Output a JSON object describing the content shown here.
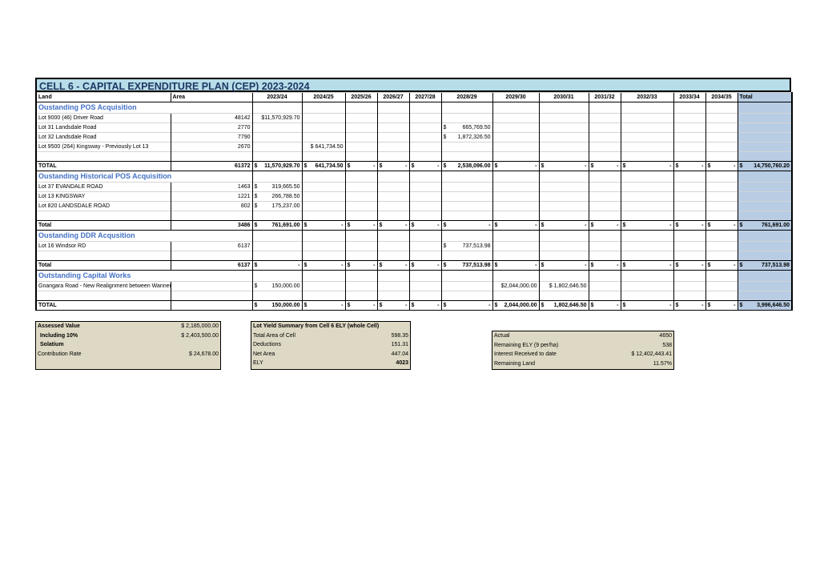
{
  "title": "CELL 6 - CAPITAL EXPENDITURE PLAN (CEP) 2023-2024",
  "columns": [
    "Land",
    "Area",
    "2023/24",
    "2024/25",
    "2025/26",
    "2026/27",
    "2027/28",
    "2028/29",
    "2029/30",
    "2030/31",
    "2031/32",
    "2032/33",
    "2033/34",
    "2034/35",
    "Total"
  ],
  "sections": [
    {
      "heading": "Oustanding POS Acquisition",
      "rows": [
        {
          "land": "Lot 9000 (46) Driver Road",
          "area": "48142",
          "vals": {
            "2023/24": [
              "",
              "$11,570,929.70"
            ]
          }
        },
        {
          "land": "Lot 31 Landsdale Road",
          "area": "2770",
          "vals": {
            "2028/29": [
              "$",
              "665,769.50"
            ]
          }
        },
        {
          "land": "Lot 32 Landsdale Road",
          "area": "7790",
          "vals": {
            "2028/29": [
              "$",
              "1,872,326.50"
            ]
          }
        },
        {
          "land": "Lot 9500 (264) Kingsway - Previously Lot 13",
          "area": "2670",
          "vals": {
            "2024/25": [
              "",
              "$ 641,734.50"
            ]
          }
        }
      ],
      "total_label": "TOTAL",
      "total_area": "61372",
      "totals": [
        "$11,570,929.70",
        "$ 641,734.50",
        "$ -",
        "$ -",
        "$ -",
        "$ 2,538,096.00",
        "$ -",
        "$ -",
        "$ -",
        "$ -",
        "$ -",
        "$ -",
        "$ 14,750,760.20"
      ]
    },
    {
      "heading": "Oustanding Historical POS Acquisition",
      "rows": [
        {
          "land": "Lot 37 EVANDALE ROAD",
          "area": "1463",
          "vals": {
            "2023/24": [
              "$",
              "319,665.50"
            ]
          }
        },
        {
          "land": "Lot 13 KINGSWAY",
          "area": "1221",
          "vals": {
            "2023/24": [
              "$",
              "266,788.50"
            ]
          }
        },
        {
          "land": "Lot 820  LANDSDALE ROAD",
          "area": "802",
          "vals": {
            "2023/24": [
              "$",
              "175,237.00"
            ]
          }
        }
      ],
      "total_label": "Total",
      "total_area": "3486",
      "totals": [
        "$ 761,691.00",
        "$ -",
        "$ -",
        "$ -",
        "$ -",
        "$ -",
        "$ -",
        "$ -",
        "$ -",
        "$ -",
        "$ -",
        "$ -",
        "$ 761,691.00"
      ]
    },
    {
      "heading": "Oustanding DDR Acqusition",
      "rows": [
        {
          "land": "Lot 16 Windsor RD",
          "area": "6137",
          "vals": {
            "2028/29": [
              "$",
              "737,513.98"
            ]
          }
        }
      ],
      "total_label": "Total",
      "total_area": "6137",
      "totals": [
        "$ -",
        "$ -",
        "$ -",
        "$ -",
        "$ -",
        "$ 737,513.98",
        "$ -",
        "$ -",
        "$ -",
        "$ -",
        "$ -",
        "$ -",
        "$ 737,513.98"
      ]
    },
    {
      "heading": "Outstanding Capital Works",
      "rows": [
        {
          "land": "Gnangara Road - New Realignment between Wanneroo Rd to Hartman Drive",
          "area": "",
          "vals": {
            "2023/24": [
              "$",
              "150,000.00"
            ],
            "2029/30": [
              "",
              "$2,044,000.00"
            ],
            "2030/31": [
              "",
              "$ 1,802,646.50"
            ]
          }
        }
      ],
      "total_label": "TOTAL",
      "total_area": "",
      "totals": [
        "$ 150,000.00",
        "$ -",
        "$ -",
        "$ -",
        "$ -",
        "$ -",
        "$2,044,000.00",
        "$ 1,802,646.50",
        "$ -",
        "$ -",
        "$ -",
        "$ -",
        "$ 3,996,646.50"
      ]
    }
  ],
  "assessed": [
    {
      "label": "Assessed Value",
      "value": "$ 2,185,000.00",
      "bold": true
    },
    {
      "label": "Including 10%",
      "value": "$ 2,403,500.00",
      "bold": true
    },
    {
      "label": "Solatium",
      "value": "",
      "bold": true
    },
    {
      "label": "Contribution Rate",
      "value": "$ 24,678.00",
      "bold": false
    }
  ],
  "lot_yield": {
    "heading": "Lot Yield Summary from Cell 6 ELY (whole Cell)",
    "rows": [
      {
        "label": "Total Area of Cell",
        "value": "598.35"
      },
      {
        "label": "Deductions",
        "value": "151.31"
      },
      {
        "label": "Net Area",
        "value": "447.04"
      },
      {
        "label": "ELY",
        "value": "4023"
      }
    ]
  },
  "actual": [
    {
      "label": "Actual",
      "value": "4650"
    },
    {
      "label": "Remaining ELY (9 per/ha)",
      "value": "538"
    },
    {
      "label": "Interest Received to date",
      "value": "$ 12,402,443.41"
    },
    {
      "label": "Remaining Land",
      "value": "11.57%"
    }
  ]
}
